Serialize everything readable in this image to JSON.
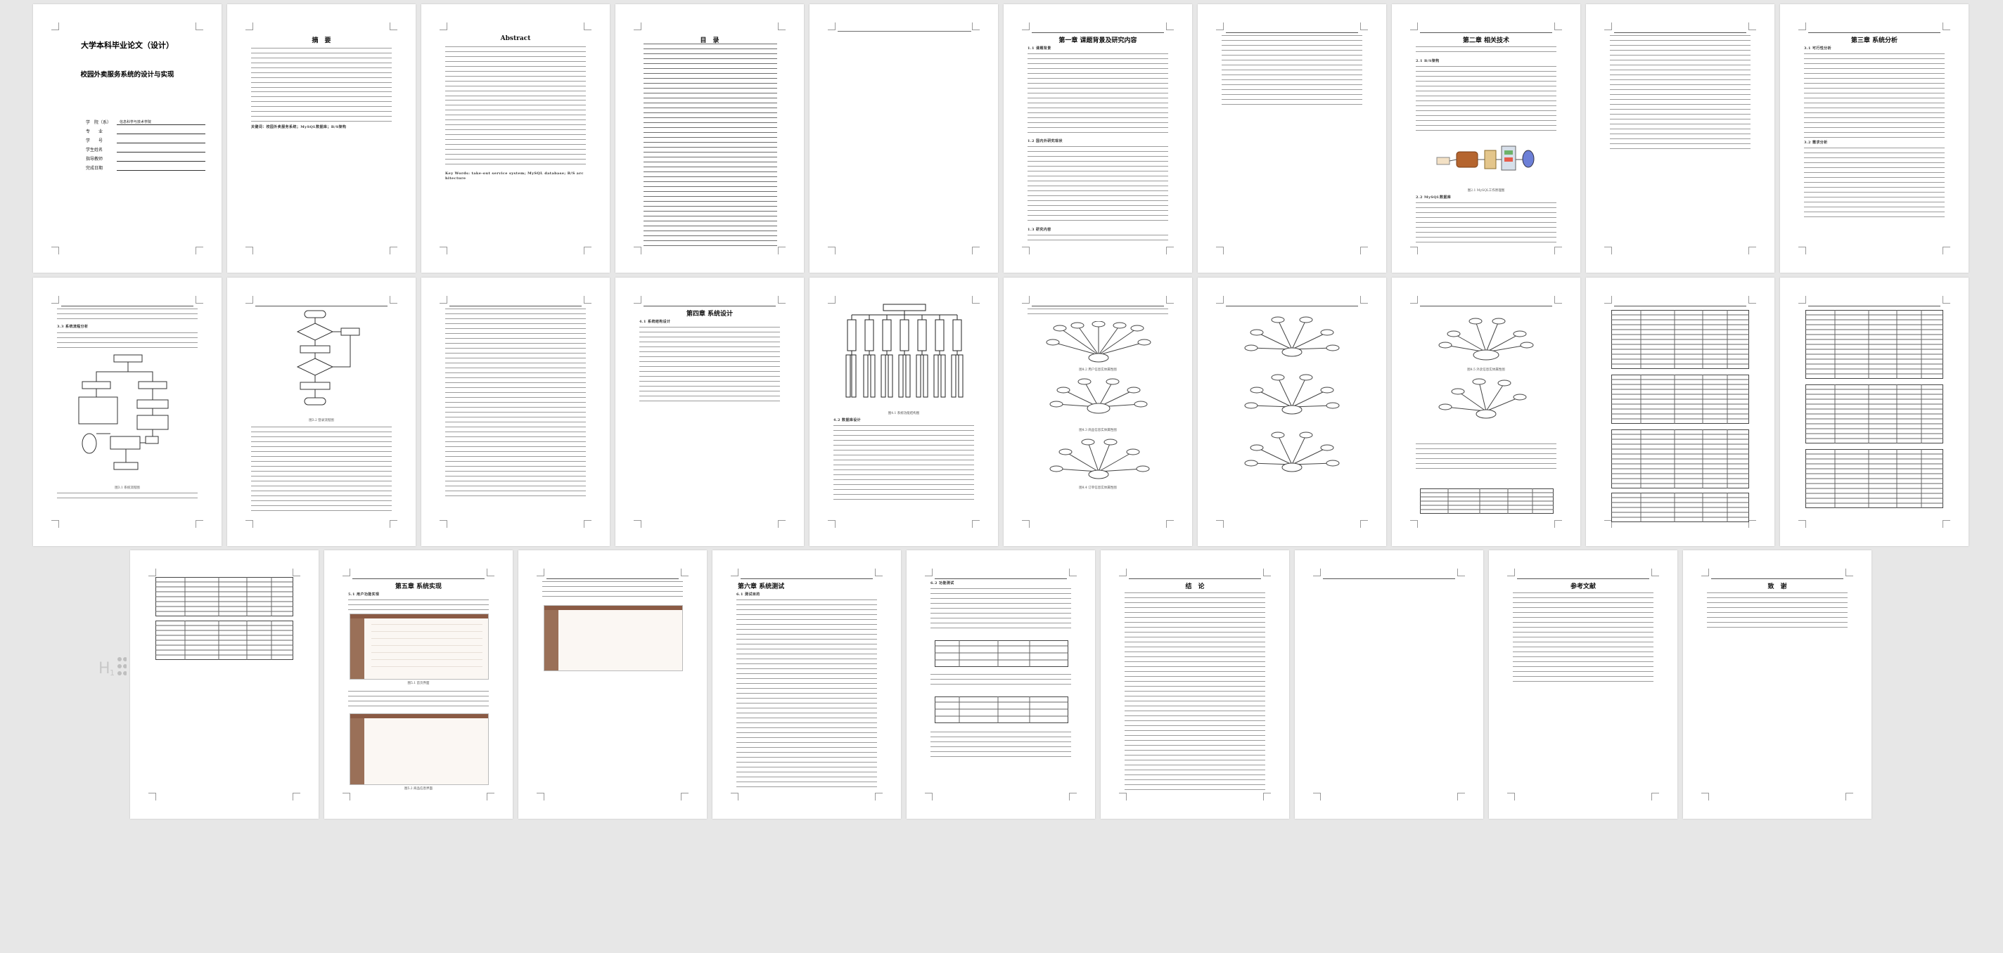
{
  "document": {
    "cover": {
      "thesis_type": "大学本科毕业论文（设计）",
      "title": "校园外卖服务系统的设计与实现",
      "fields": [
        {
          "label": "学　院（系）",
          "value": "信息科学与技术学院"
        },
        {
          "label": "专　　业",
          "value": ""
        },
        {
          "label": "学　　号",
          "value": ""
        },
        {
          "label": "学生姓名",
          "value": ""
        },
        {
          "label": "指导教师",
          "value": ""
        },
        {
          "label": "完成日期",
          "value": ""
        }
      ]
    },
    "abstract_cn": {
      "heading": "摘　要",
      "keywords": "关键词：校园外卖服务系统；MySQL数据库；B/S架构"
    },
    "abstract_en": {
      "heading": "Abstract",
      "keywords": "Key Words: take-out service system; MySQL database; B/S architecture"
    },
    "toc": {
      "heading": "目　录"
    },
    "chapters": {
      "ch1": "第一章 课题背景及研究内容",
      "ch2": "第二章 相关技术",
      "ch3": "第三章 系统分析",
      "ch4": "第四章 系统设计",
      "ch5": "第五章 系统实现",
      "ch6": "第六章 系统测试",
      "conclusion": "结　论",
      "references": "参考文献",
      "thanks": "致　谢"
    },
    "sections": {
      "s1_1": "1.1 课题背景",
      "s1_2": "1.2 国内外研究现状",
      "s1_3": "1.3 研究内容",
      "s2_1": "2.1 B/S架构",
      "s2_2": "2.2 MySQL数据库",
      "s3_1": "3.1 可行性分析",
      "s3_2": "3.2 需求分析",
      "s3_3": "3.3 系统流程分析",
      "s4_1": "4.1 系统结构设计",
      "s4_2": "4.2 数据库设计",
      "s5_1": "5.1 用户功能实现",
      "s6_1": "6.1 测试目的",
      "s6_2": "6.2 功能测试"
    },
    "figures": {
      "ch2_fig": "图2.1 MySQL工作原理图",
      "ch3_fig1": "图3.1 系统流程图",
      "ch3_fig2": "图3.2 登录流程图",
      "ch4_fig1": "图4.1 系统功能结构图",
      "er1": "图4.2 用户信息实体属性图",
      "er2": "图4.3 商品信息实体属性图",
      "er3": "图4.4 订单信息实体属性图",
      "er4": "图4.5 外卖信息实体属性图",
      "ch5_fig1": "图5.1 首页界面",
      "ch5_fig2": "图5.2 商品信息界面"
    },
    "diagram_labels": {
      "login": "登录",
      "system": "系统",
      "user_info": "用户信息",
      "order": "订单信息",
      "takeout": "外卖信息",
      "admin": "管理员",
      "db": "数据库"
    }
  }
}
